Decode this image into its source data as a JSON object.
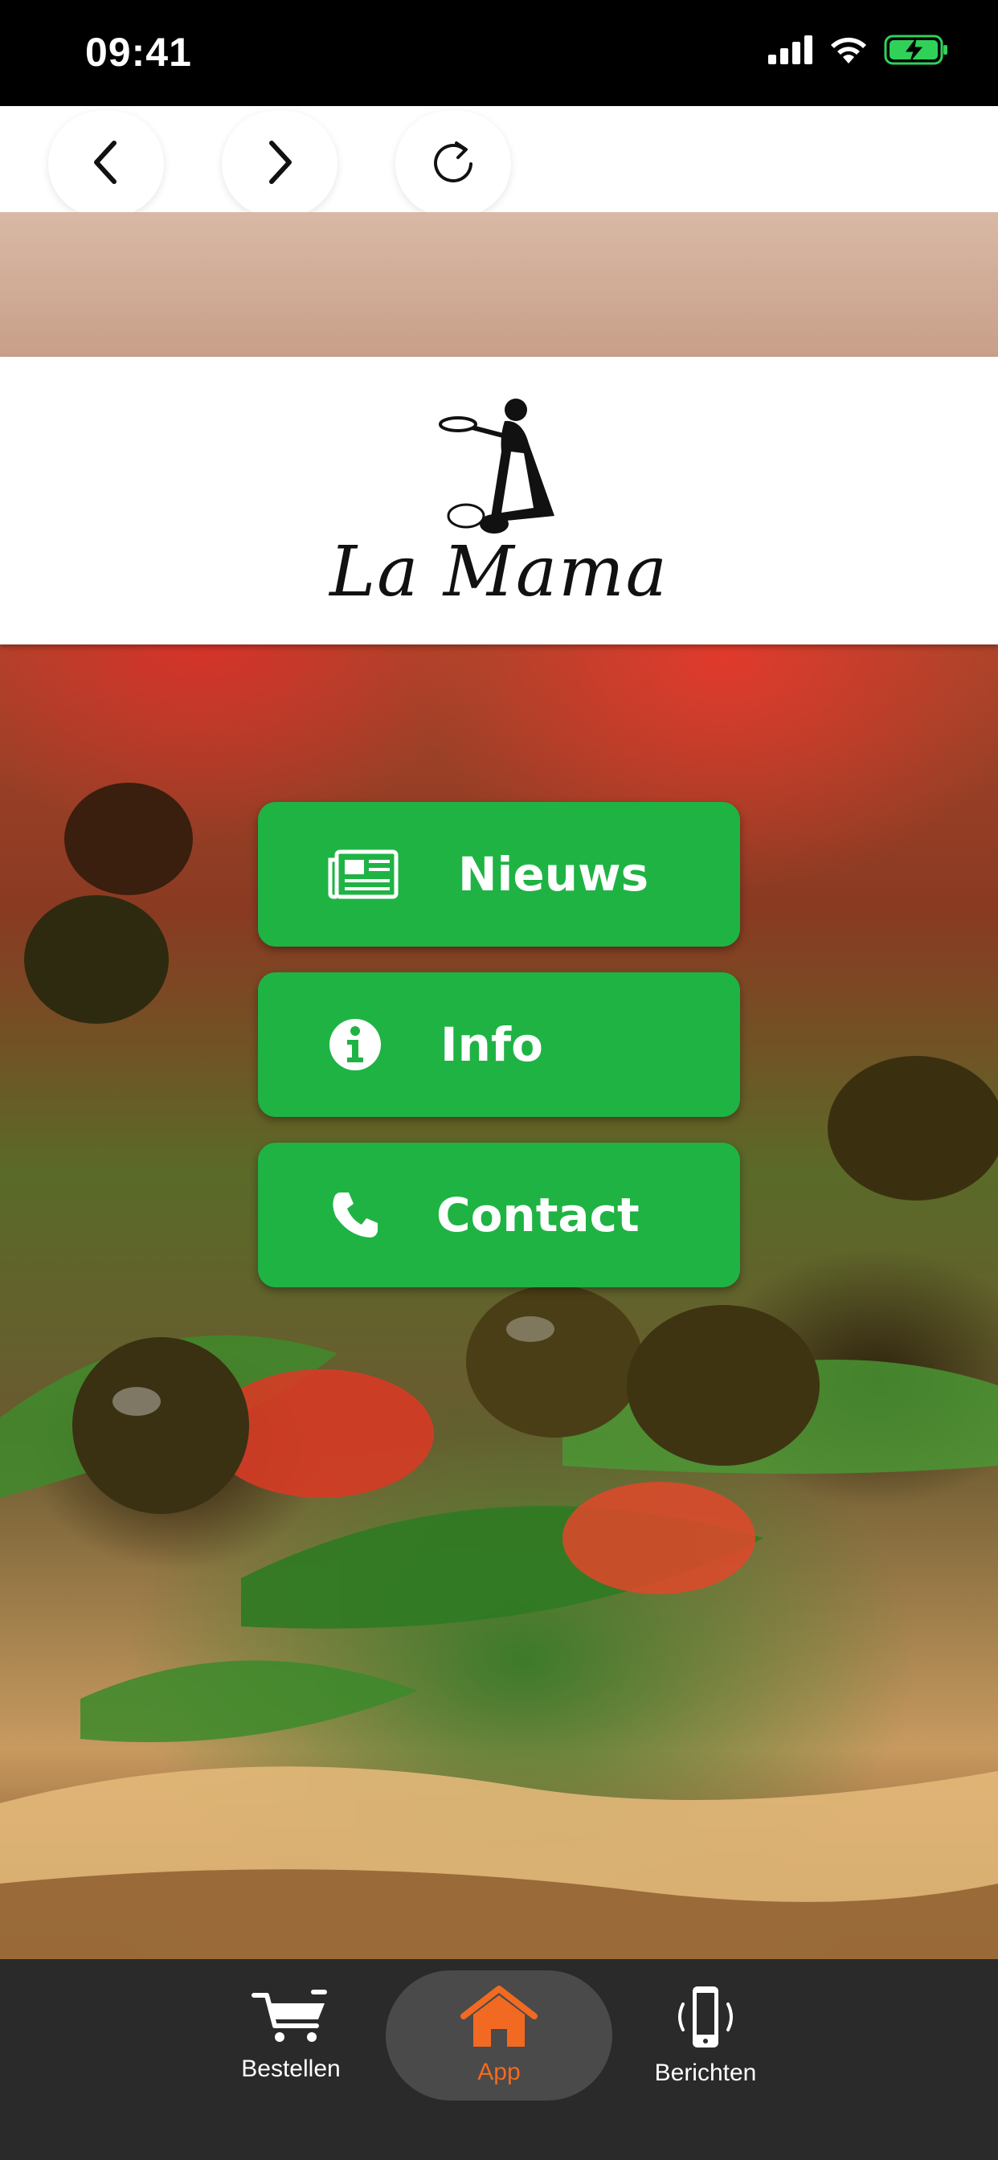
{
  "status_bar": {
    "time": "09:41",
    "icons": [
      "signal-icon",
      "wifi-icon",
      "battery-charging-icon"
    ],
    "battery_color": "#30d158"
  },
  "browser": {
    "buttons": [
      "back-icon",
      "forward-icon",
      "reload-icon"
    ]
  },
  "logo": {
    "text": "La Mama"
  },
  "menu": {
    "accent": "#1fb344",
    "items": [
      {
        "label": "Nieuws",
        "icon": "newspaper-icon"
      },
      {
        "label": "Info",
        "icon": "info-icon"
      },
      {
        "label": "Contact",
        "icon": "phone-icon"
      }
    ]
  },
  "tab_bar": {
    "active_color": "#f26a21",
    "items": [
      {
        "label": "Bestellen",
        "icon": "cart-icon"
      },
      {
        "label": "App",
        "icon": "home-icon",
        "active": true
      },
      {
        "label": "Berichten",
        "icon": "phone-vibrate-icon"
      }
    ]
  }
}
